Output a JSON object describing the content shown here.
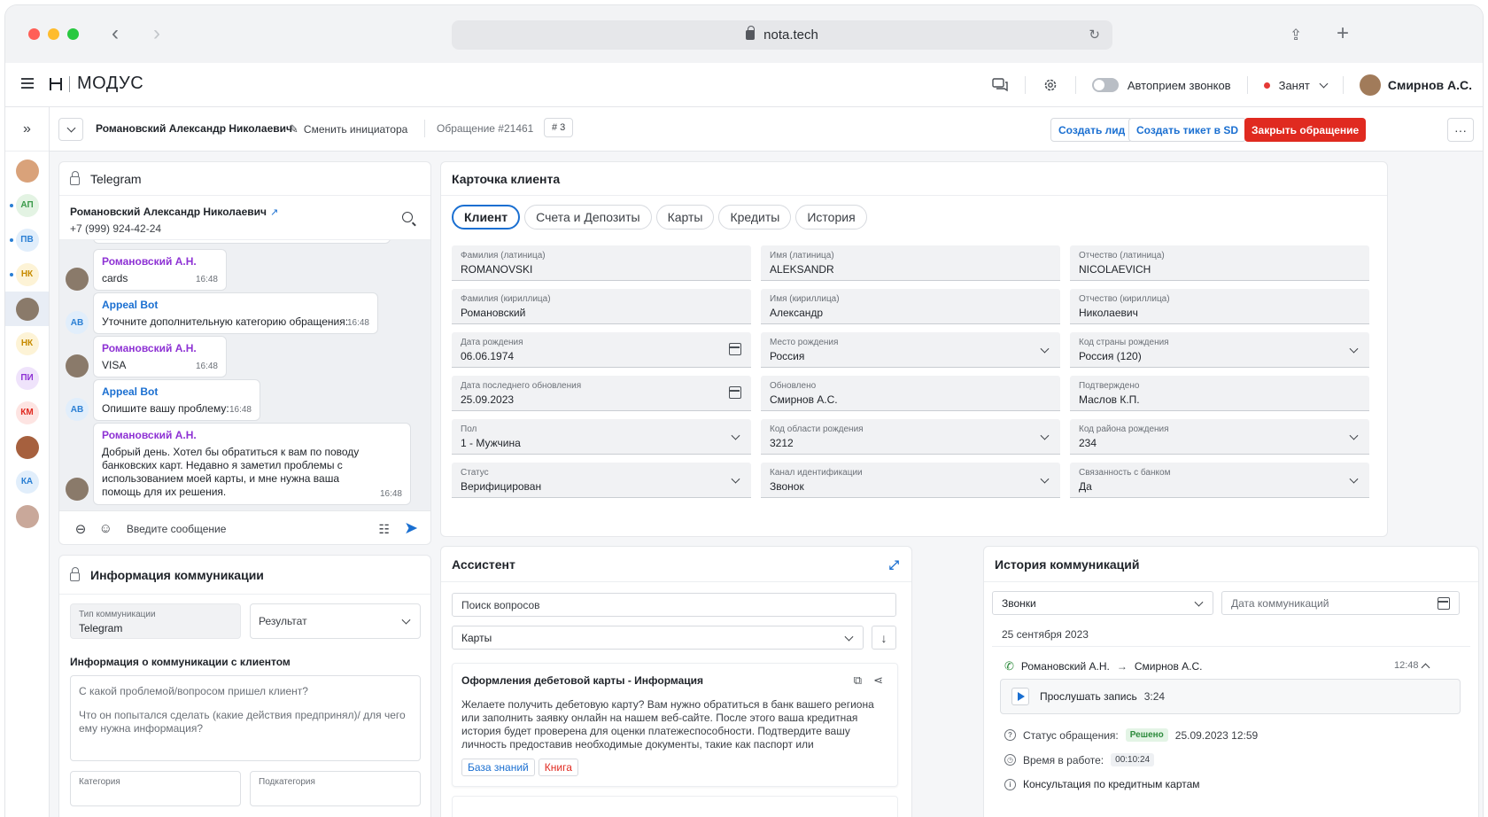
{
  "browser": {
    "url": "nota.tech"
  },
  "app": {
    "logo": "МОДУС",
    "autoaccept_label": "Автоприем звонков",
    "status_label": "Занят",
    "user_name": "Смирнов А.С."
  },
  "rail": {
    "items": [
      {
        "type": "photo",
        "color": "#d9a27a"
      },
      {
        "type": "initials",
        "text": "АП",
        "bg": "#e3f3e3",
        "fg": "#3a9a4a",
        "dot": true
      },
      {
        "type": "initials",
        "text": "ПВ",
        "bg": "#e1eefb",
        "fg": "#2a7fd4",
        "dot": true
      },
      {
        "type": "initials",
        "text": "НК",
        "bg": "#fdf3d6",
        "fg": "#c78b00",
        "dot": true
      },
      {
        "type": "photo",
        "color": "#8a7a6a",
        "active": true
      },
      {
        "type": "initials",
        "text": "НК",
        "bg": "#fdf3d6",
        "fg": "#c78b00"
      },
      {
        "type": "initials",
        "text": "ПИ",
        "bg": "#efe3fb",
        "fg": "#8e32d4"
      },
      {
        "type": "initials",
        "text": "КМ",
        "bg": "#fde4e2",
        "fg": "#e02a20"
      },
      {
        "type": "photo",
        "color": "#a6603e"
      },
      {
        "type": "initials",
        "text": "КА",
        "bg": "#e1eefb",
        "fg": "#2a7fd4"
      },
      {
        "type": "photo",
        "color": "#c9a89a"
      }
    ]
  },
  "toolbar": {
    "initiator": "Романовский Александр Николаевич",
    "change_initiator": "Сменить инициатора",
    "appeal": "Обращение #21461",
    "count": "# 3",
    "create_lead": "Создать лид",
    "create_ticket": "Создать тикет в SD",
    "close_appeal": "Закрыть обращение",
    "more": "···"
  },
  "telegram": {
    "title": "Telegram",
    "contact_name": "Романовский Александр Николаевич",
    "contact_phone": "+7 (999) 924-42-24",
    "messages": [
      {
        "from": "client",
        "author": "Романовский А.Н.",
        "text": "cards",
        "time": "16:48"
      },
      {
        "from": "bot",
        "author": "Appeal Bot",
        "avatar": "AB",
        "text": "Уточните дополнительную категорию обращения:",
        "time": "16:48"
      },
      {
        "from": "client",
        "author": "Романовский А.Н.",
        "text": "VISA",
        "time": "16:48"
      },
      {
        "from": "bot",
        "author": "Appeal Bot",
        "avatar": "AB",
        "text": "Опишите вашу проблему:",
        "time": "16:48"
      },
      {
        "from": "client",
        "author": "Романовский А.Н.",
        "text": "Добрый день. Хотел бы обратиться к вам по поводу банковских карт. Недавно я заметил проблемы с использованием моей карты, и мне нужна ваша помощь для их решения.",
        "time": "16:48"
      }
    ],
    "input_placeholder": "Введите сообщение"
  },
  "comm_info": {
    "title": "Информация коммуникации",
    "type_label": "Тип коммуникации",
    "type_value": "Telegram",
    "result_placeholder": "Результат",
    "section_title": "Информация о коммуникации с клиентом",
    "textarea_placeholder_1": "С какой проблемой/вопросом пришел клиент?",
    "textarea_placeholder_2": "Что он попытался сделать (какие действия предпринял)/ для чего ему нужна информация?",
    "category_label": "Категория",
    "subcategory_label": "Подкатегория"
  },
  "client_card": {
    "title": "Карточка клиента",
    "tabs": [
      "Клиент",
      "Счета и Депозиты",
      "Карты",
      "Кредиты",
      "История"
    ],
    "fields": [
      {
        "label": "Фамилия (латиница)",
        "value": "ROMANOVSKI",
        "icon": ""
      },
      {
        "label": "Имя (латиница)",
        "value": "ALEKSANDR",
        "icon": ""
      },
      {
        "label": "Отчество (латиница)",
        "value": "NICOLAEVICH",
        "icon": ""
      },
      {
        "label": "Фамилия (кириллица)",
        "value": "Романовский",
        "icon": ""
      },
      {
        "label": "Имя (кириллица)",
        "value": "Александр",
        "icon": ""
      },
      {
        "label": "Отчество (кириллица)",
        "value": "Николаевич",
        "icon": ""
      },
      {
        "label": "Дата рождения",
        "value": "06.06.1974",
        "icon": "calendar"
      },
      {
        "label": "Место рождения",
        "value": "Россия",
        "icon": "chevron"
      },
      {
        "label": "Код страны рождения",
        "value": "Россия (120)",
        "icon": "chevron"
      },
      {
        "label": "Дата последнего обновления",
        "value": "25.09.2023",
        "icon": "calendar"
      },
      {
        "label": "Обновлено",
        "value": "Смирнов А.С.",
        "icon": ""
      },
      {
        "label": "Подтверждено",
        "value": "Маслов К.П.",
        "icon": ""
      },
      {
        "label": "Пол",
        "value": "1 - Мужчина",
        "icon": "chevron"
      },
      {
        "label": "Код области рождения",
        "value": "3212",
        "icon": "chevron"
      },
      {
        "label": "Код района рождения",
        "value": "234",
        "icon": "chevron"
      },
      {
        "label": "Статус",
        "value": "Верифицирован",
        "icon": "chevron"
      },
      {
        "label": "Канал идентификации",
        "value": "Звонок",
        "icon": "chevron"
      },
      {
        "label": "Связанность с банком",
        "value": "Да",
        "icon": "chevron"
      }
    ]
  },
  "assistant": {
    "title": "Ассистент",
    "search_placeholder": "Поиск вопросов",
    "category_value": "Карты",
    "article_title": "Оформления дебетовой карты - Информация",
    "article_text": "Желаете получить дебетовую карту? Вам нужно обратиться в банк вашего региона или заполнить заявку онлайн на нашем веб-сайте. После этого ваша кредитная история будет проверена для оценки платежеспособности. Подтвердите вашу личность предоставив необходимые документы, такие как паспорт или удостоверение личности. Выберите под...",
    "tag_kb": "База знаний",
    "tag_book": "Книга"
  },
  "history": {
    "title": "История коммуникаций",
    "type_value": "Звонки",
    "date_placeholder": "Дата коммуникаций",
    "date_header": "25 сентября 2023",
    "from": "Романовский А.Н.",
    "to": "Смирнов А.С.",
    "time": "12:48",
    "play_label": "Прослушать запись",
    "duration": "3:24",
    "status_label": "Статус обращения:",
    "status_badge": "Решено",
    "status_date": "25.09.2023 12:59",
    "work_time_label": "Время в работе:",
    "work_time": "00:10:24",
    "topic": "Консультация по кредитным картам"
  }
}
